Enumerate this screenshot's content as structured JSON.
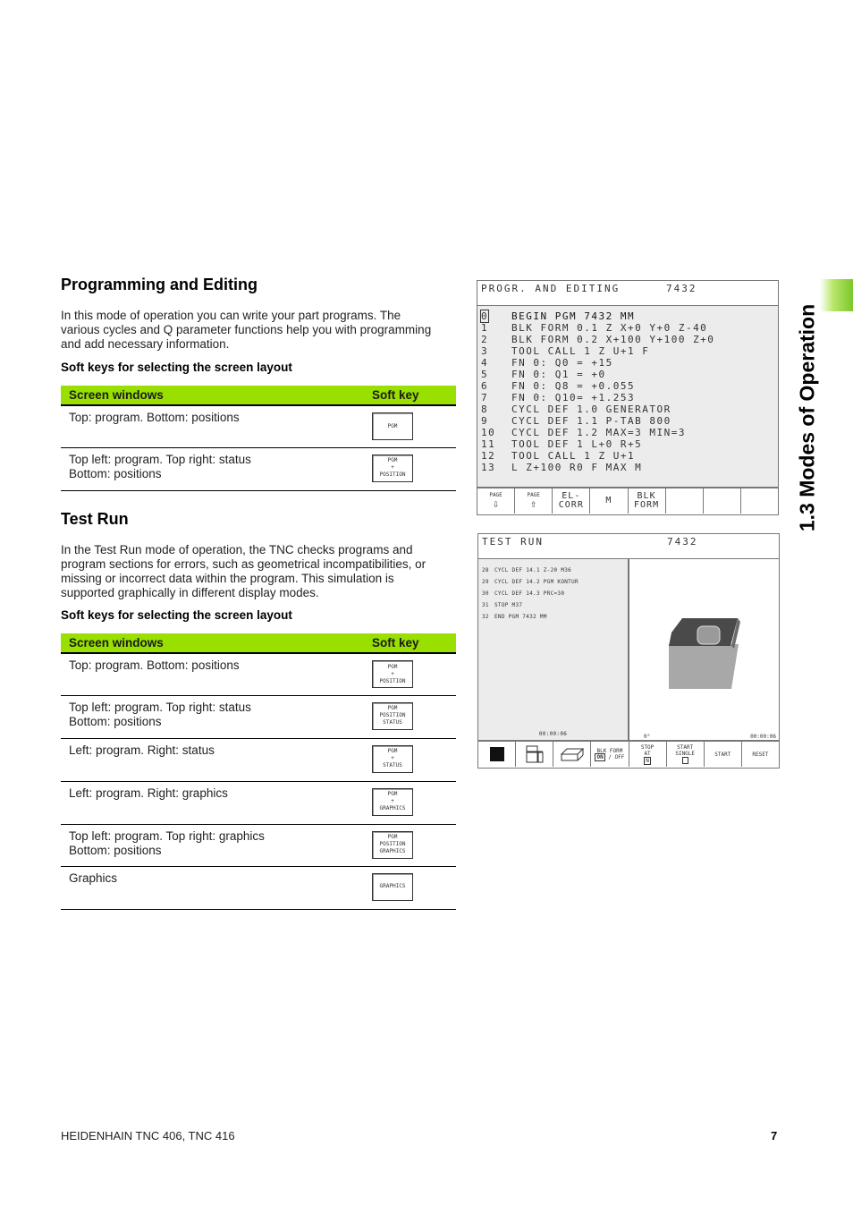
{
  "sidebar": {
    "chapter_title": "1.3 Modes of Operation",
    "accent_color": "#7ac72a"
  },
  "section1": {
    "heading": "Programming and Editing",
    "paragraph_lines": [
      "In this mode of operation you can write your part programs. The",
      "various cycles and Q parameter functions help you with programming",
      "and add necessary information."
    ],
    "subheading": "Soft keys for selecting the screen layout",
    "table": {
      "headers": [
        "Screen windows",
        "Soft key"
      ],
      "rows": [
        {
          "lines": [
            "Top: program. Bottom: positions"
          ],
          "softkey": [
            "PGM"
          ]
        },
        {
          "lines": [
            "Top left: program. Top right: status",
            "Bottom: positions"
          ],
          "softkey": [
            "PGM",
            "+",
            "POSITION"
          ]
        }
      ]
    }
  },
  "section2": {
    "heading": "Test Run",
    "paragraph_lines": [
      "In the Test Run mode of operation, the TNC checks programs and",
      "program sections for errors, such as geometrical incompatibilities, or",
      "missing or incorrect data within the program. This simulation is",
      "supported graphically in different display modes."
    ],
    "subheading": "Soft keys for selecting the screen layout",
    "table": {
      "headers": [
        "Screen windows",
        "Soft key"
      ],
      "rows": [
        {
          "lines": [
            "Top: program. Bottom: positions"
          ],
          "softkey": [
            "PGM",
            "+",
            "POSITION"
          ]
        },
        {
          "lines": [
            "Top left: program. Top right: status",
            "Bottom: positions"
          ],
          "softkey": [
            "PGM",
            "POSITION",
            "STATUS"
          ]
        },
        {
          "lines": [
            "Left: program. Right: status"
          ],
          "softkey": [
            "PGM",
            "+",
            "STATUS"
          ]
        },
        {
          "lines": [
            "Left: program. Right: graphics"
          ],
          "softkey": [
            "PGM",
            "+",
            "GRAPHICS"
          ]
        },
        {
          "lines": [
            "Top left: program. Top right: graphics",
            "Bottom: positions"
          ],
          "softkey": [
            "PGM",
            "POSITION",
            "GRAPHICS"
          ]
        },
        {
          "lines": [
            "Graphics"
          ],
          "softkey": [
            "GRAPHICS"
          ]
        }
      ]
    }
  },
  "screen1": {
    "title": "PROGR. AND EDITING",
    "program_number": "7432",
    "lines": [
      [
        "0",
        "BEGIN PGM 7432 MM"
      ],
      [
        "1",
        "BLK FORM 0.1 Z X+0 Y+0 Z-40"
      ],
      [
        "2",
        "BLK FORM 0.2 X+100 Y+100 Z+0"
      ],
      [
        "3",
        "TOOL CALL 1 Z U+1 F"
      ],
      [
        "4",
        "FN 0: Q0 = +15"
      ],
      [
        "5",
        "FN 0: Q1 = +0"
      ],
      [
        "6",
        "FN 0: Q8 = +0.055"
      ],
      [
        "7",
        "FN 0: Q10= +1.253"
      ],
      [
        "8",
        "CYCL DEF 1.0 GENERATOR"
      ],
      [
        "9",
        "CYCL DEF 1.1 P-TAB 800"
      ],
      [
        "10",
        "CYCL DEF 1.2 MAX=3 MIN=3"
      ],
      [
        "11",
        "TOOL DEF 1 L+0 R+5"
      ],
      [
        "12",
        "TOOL CALL 1 Z U+1"
      ],
      [
        "13",
        "L Z+100 R0 F MAX M"
      ]
    ],
    "softkeys": [
      {
        "top": "PAGE",
        "bottom": "⇩"
      },
      {
        "top": "PAGE",
        "bottom": "⇧"
      },
      {
        "top": "EL-",
        "bottom": "CORR"
      },
      {
        "top": "M",
        "bottom": ""
      },
      {
        "top": "BLK",
        "bottom": "FORM"
      },
      {
        "top": "",
        "bottom": ""
      },
      {
        "top": "",
        "bottom": ""
      },
      {
        "top": "",
        "bottom": ""
      }
    ]
  },
  "screen2": {
    "title": "TEST RUN",
    "program_number": "7432",
    "lines": [
      [
        "28",
        "CYCL DEF 14.1 Z-20 M36"
      ],
      [
        "29",
        "CYCL DEF 14.2 PGM KONTUR"
      ],
      [
        "30",
        "CYCL DEF 14.3 PRC=30"
      ],
      [
        "31",
        "STOP M37"
      ],
      [
        "32",
        "END PGM 7432 MM"
      ]
    ],
    "left_time": "00:00:06",
    "angle": "0°",
    "right_time": "00:00:06",
    "softkeys": {
      "blk_form": "BLK FORM",
      "on": "ON",
      "off": "/ OFF",
      "stop": "STOP",
      "at": "AT",
      "n": "N",
      "start": "START",
      "single": "SINGLE",
      "start_label": "START",
      "reset": "RESET"
    }
  },
  "footer": {
    "manual_title": "HEIDENHAIN TNC 406, TNC 416",
    "page_number": "7"
  }
}
